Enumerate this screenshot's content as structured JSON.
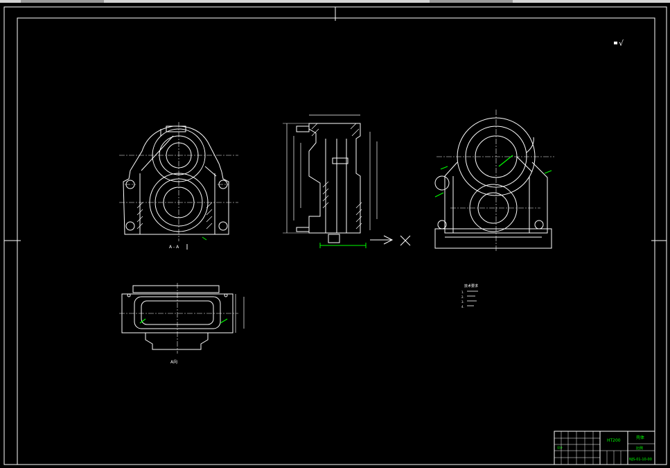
{
  "drawing": {
    "roughness_symbol": "√",
    "section_label_front": "A - A",
    "section_label_bottom": "A向",
    "notes_heading": "技术要求",
    "notes_lines": [
      "1.",
      "2.",
      "3.",
      "4."
    ],
    "colors": {
      "background": "#000000",
      "lines": "#ffffff",
      "dimensions": "#00ff00",
      "centerlines": "#ffffff"
    }
  },
  "title_block": {
    "material": "HT200",
    "part_name": "壳体",
    "designer_label": "设计",
    "scale_label": "比例",
    "drawing_number": "NJS-01-10-00"
  }
}
